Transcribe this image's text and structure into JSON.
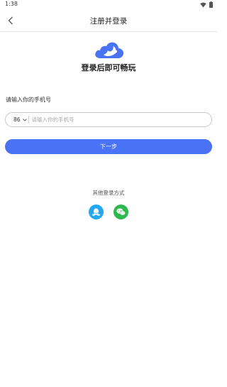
{
  "status_bar": {
    "time": "1:38",
    "icons": [
      "wifi-icon",
      "battery-icon"
    ]
  },
  "header": {
    "title": "注册并登录",
    "back_icon": "chevron-left-icon"
  },
  "logo": {
    "icon": "cloud-bird-logo-icon",
    "color": "#4a72f5"
  },
  "slogan": "登录后即可畅玩",
  "phone": {
    "prompt": "请输入你的手机号",
    "country_code": "86",
    "placeholder": "请输入你的手机号",
    "value": ""
  },
  "next_button": {
    "label": "下一步",
    "color": "#4a72f5"
  },
  "other_login": {
    "label": "其他登录方式",
    "methods": [
      {
        "icon": "qq-icon",
        "color": "#23a7f0"
      },
      {
        "icon": "wechat-icon",
        "color": "#2db94d"
      }
    ]
  }
}
